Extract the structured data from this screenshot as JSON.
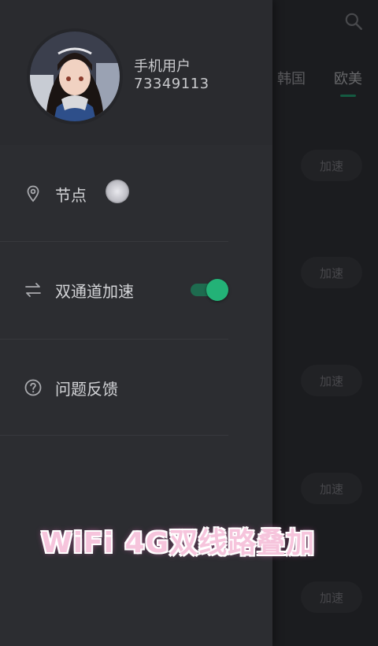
{
  "background": {
    "tabs": [
      {
        "label": "韩国"
      },
      {
        "label": "欧美"
      }
    ],
    "boost_buttons": [
      "加速",
      "加速",
      "加速",
      "加速",
      "加速"
    ]
  },
  "drawer": {
    "user": {
      "name": "手机用户",
      "id": "73349113"
    },
    "menu": [
      {
        "label": "节点",
        "icon": "location-pin-icon"
      },
      {
        "label": "双通道加速",
        "icon": "swap-arrows-icon",
        "toggle_on": true
      },
      {
        "label": "问题反馈",
        "icon": "help-circle-icon"
      }
    ]
  },
  "caption": "WiFi 4G双线路叠加",
  "colors": {
    "accent": "#23b277",
    "tab_underline": "#1f8a64",
    "caption": "#f6c4dc"
  }
}
